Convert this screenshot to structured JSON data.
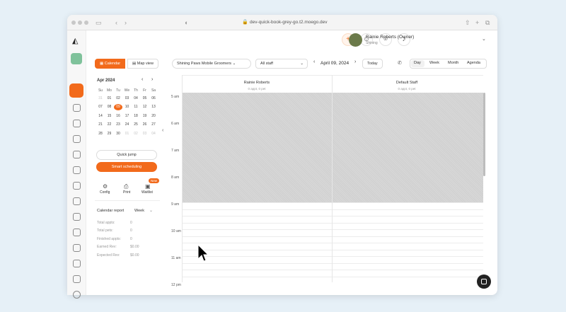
{
  "browser": {
    "url": "dev-quick-book-grey-go.t2.moego.dev"
  },
  "header": {
    "user_name": "Rainie Roberts (Owner)",
    "user_sub": "Shining"
  },
  "toolbar": {
    "calendar_tab": "Calendar",
    "map_tab": "Map view",
    "business": "Shining Paws Mobile Groomers",
    "staff_filter": "All staff",
    "date": "April 09, 2024",
    "today": "Today",
    "views": [
      "Day",
      "Week",
      "Month",
      "Agenda"
    ]
  },
  "mini_calendar": {
    "month": "Apr 2024",
    "weekdays": [
      "Su",
      "Mo",
      "Tu",
      "We",
      "Th",
      "Fr",
      "Sa"
    ],
    "rows": [
      [
        "31",
        "01",
        "02",
        "03",
        "04",
        "05",
        "06"
      ],
      [
        "07",
        "08",
        "09",
        "10",
        "11",
        "12",
        "13"
      ],
      [
        "14",
        "15",
        "16",
        "17",
        "18",
        "19",
        "20"
      ],
      [
        "21",
        "22",
        "23",
        "24",
        "25",
        "26",
        "27"
      ],
      [
        "28",
        "29",
        "30",
        "01",
        "02",
        "03",
        "04"
      ]
    ],
    "selected": "09"
  },
  "left_panel": {
    "quick_jump": "Quick jump",
    "smart_scheduling": "Smart scheduling",
    "config": "Config",
    "print": "Print",
    "waitlist": "Waitlist",
    "new_badge": "New",
    "report_title": "Calendar report",
    "report_period": "Week",
    "stats": [
      {
        "label": "Total appts:",
        "value": "0"
      },
      {
        "label": "Total pets:",
        "value": "0"
      },
      {
        "label": "Finished appts:",
        "value": "0"
      },
      {
        "label": "Earned Rev:",
        "value": "$0.00"
      },
      {
        "label": "Expected Rev:",
        "value": "$0.00"
      }
    ]
  },
  "schedule": {
    "staff": [
      {
        "name": "Rainie Roberts",
        "sub": "0 appt, 0 pet"
      },
      {
        "name": "Default Staff",
        "sub": "0 appt, 0 pet"
      }
    ],
    "hours": [
      "5 am",
      "6 am",
      "7 am",
      "8 am",
      "9 am",
      "10 am",
      "11 am",
      "12 pm"
    ]
  }
}
